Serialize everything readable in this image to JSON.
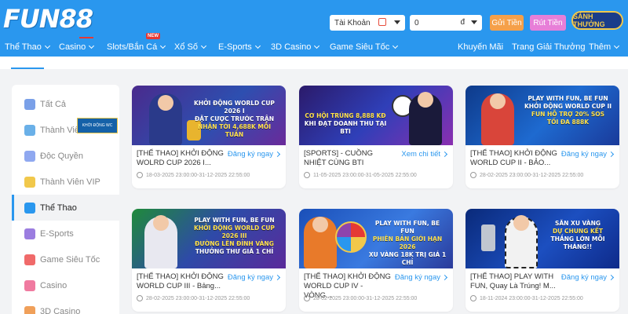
{
  "header": {
    "logo": "FUN88",
    "account_select": "Tài Khoản",
    "balance_value": "0",
    "currency": "đ",
    "deposit_label": "Gửi Tiền",
    "withdraw_label": "Rút Tiền",
    "vip_badge": "SẢNH THƯỞNG",
    "new_tag": "NEW"
  },
  "nav": {
    "items": [
      {
        "label": "Thể Thao"
      },
      {
        "label": "Casino"
      },
      {
        "label": "Slots/Bắn Cá"
      },
      {
        "label": "Xổ Số"
      },
      {
        "label": "E-Sports"
      },
      {
        "label": "3D Casino"
      },
      {
        "label": "Game Siêu Tốc"
      },
      {
        "label": "Khuyến Mãi"
      },
      {
        "label": "Trang Giải Thưởng"
      },
      {
        "label": "Thêm"
      }
    ]
  },
  "sidebar": {
    "items": [
      {
        "label": "Tất Cả",
        "icon": "grid-icon",
        "color": "#7aa0e8"
      },
      {
        "label": "Thành Viên Mới",
        "icon": "new-member-icon",
        "color": "#6ab0e8"
      },
      {
        "label": "Độc Quyền",
        "icon": "exclusive-icon",
        "color": "#8fa8f0"
      },
      {
        "label": "Thành Viên VIP",
        "icon": "vip-icon",
        "color": "#f1c84b"
      },
      {
        "label": "Thể Thao",
        "icon": "sports-icon",
        "color": "#2a97ee"
      },
      {
        "label": "E-Sports",
        "icon": "esports-icon",
        "color": "#9b7de0"
      },
      {
        "label": "Game Siêu Tốc",
        "icon": "fast-game-icon",
        "color": "#f06a6a"
      },
      {
        "label": "Casino",
        "icon": "casino-icon",
        "color": "#f07aa0"
      },
      {
        "label": "3D Casino",
        "icon": "3d-casino-icon",
        "color": "#f0a05a"
      }
    ],
    "active_thumb": "KHỞI ĐỘNG WC"
  },
  "cards": [
    {
      "banner_lines": [
        "KHỞI ĐỘNG WORLD CUP 2026 I",
        "ĐẶT CƯỢC TRƯỚC TRẬN",
        "NHẬN TỚI 4,688K MỖI TUẦN"
      ],
      "title": "[THỂ THAO] KHỞI ĐỘNG WOLRD CUP 2026 I...",
      "link": "Đăng ký ngay",
      "date": "18-03-2025 23:00:00-31-12-2025 22:55:00"
    },
    {
      "banner_lines": [
        "CƠ HỘI TRÚNG 8,888 KĐ",
        "KHI ĐẠT DOANH THU TẠI BTI"
      ],
      "title": "[SPORTS] - CUỒNG NHIỆT CÙNG BTI",
      "link": "Xem chi tiết",
      "date": "11-05-2025 23:00:00-31-05-2025 22:55:00"
    },
    {
      "banner_lines": [
        "PLAY WITH FUN, BE FUN",
        "KHỞI ĐỘNG WORLD CUP II",
        "FUN HỖ TRỢ 20% SOS",
        "TỐI ĐA 888K"
      ],
      "title": "[THỂ THAO] KHỞI ĐỘNG WORLD CUP II - BẢO...",
      "link": "Đăng ký ngay",
      "date": "28-02-2025 23:00:00-31-12-2025 22:55:00"
    },
    {
      "banner_lines": [
        "PLAY WITH FUN, BE FUN",
        "KHỞI ĐỘNG WORLD CUP 2026 III",
        "ĐƯỜNG LÊN ĐỈNH VÀNG",
        "THƯỞNG THƯ GIÃ 1 CHỈ"
      ],
      "title": "[THỂ THAO] KHỞI ĐỘNG WORLD CUP III - Bảng...",
      "link": "Đăng ký ngay",
      "date": "28-02-2025 23:00:00-31-12-2025 22:55:00"
    },
    {
      "banner_lines": [
        "PLAY WITH FUN, BE FUN",
        "PHIÊN BẢN GIỚI HẠN 2026",
        "XU VÀNG 18K TRỊ GIÁ 1 CHỈ"
      ],
      "title": "[THỂ THAO] KHỞI ĐỘNG WORLD CUP IV - VÒNG...",
      "link": "Đăng ký ngay",
      "date": "28-02-2025 23:00:00-31-12-2025 22:55:00"
    },
    {
      "banner_lines": [
        "SĂN XU VÀNG",
        "DỰ CHUNG KẾT",
        "THẮNG LỚN MỖI THÁNG!!"
      ],
      "title": "[THỂ THAO] PLAY WITH FUN, Quay Là Trúng! M...",
      "link": "Đăng ký ngay",
      "date": "18-11-2024 23:00:00-31-12-2025 22:55:00"
    }
  ],
  "colors": {
    "header_bg": "#2a97ee",
    "link": "#2a97ee",
    "deposit": "#f5a04a",
    "withdraw": "#e77fd8"
  }
}
